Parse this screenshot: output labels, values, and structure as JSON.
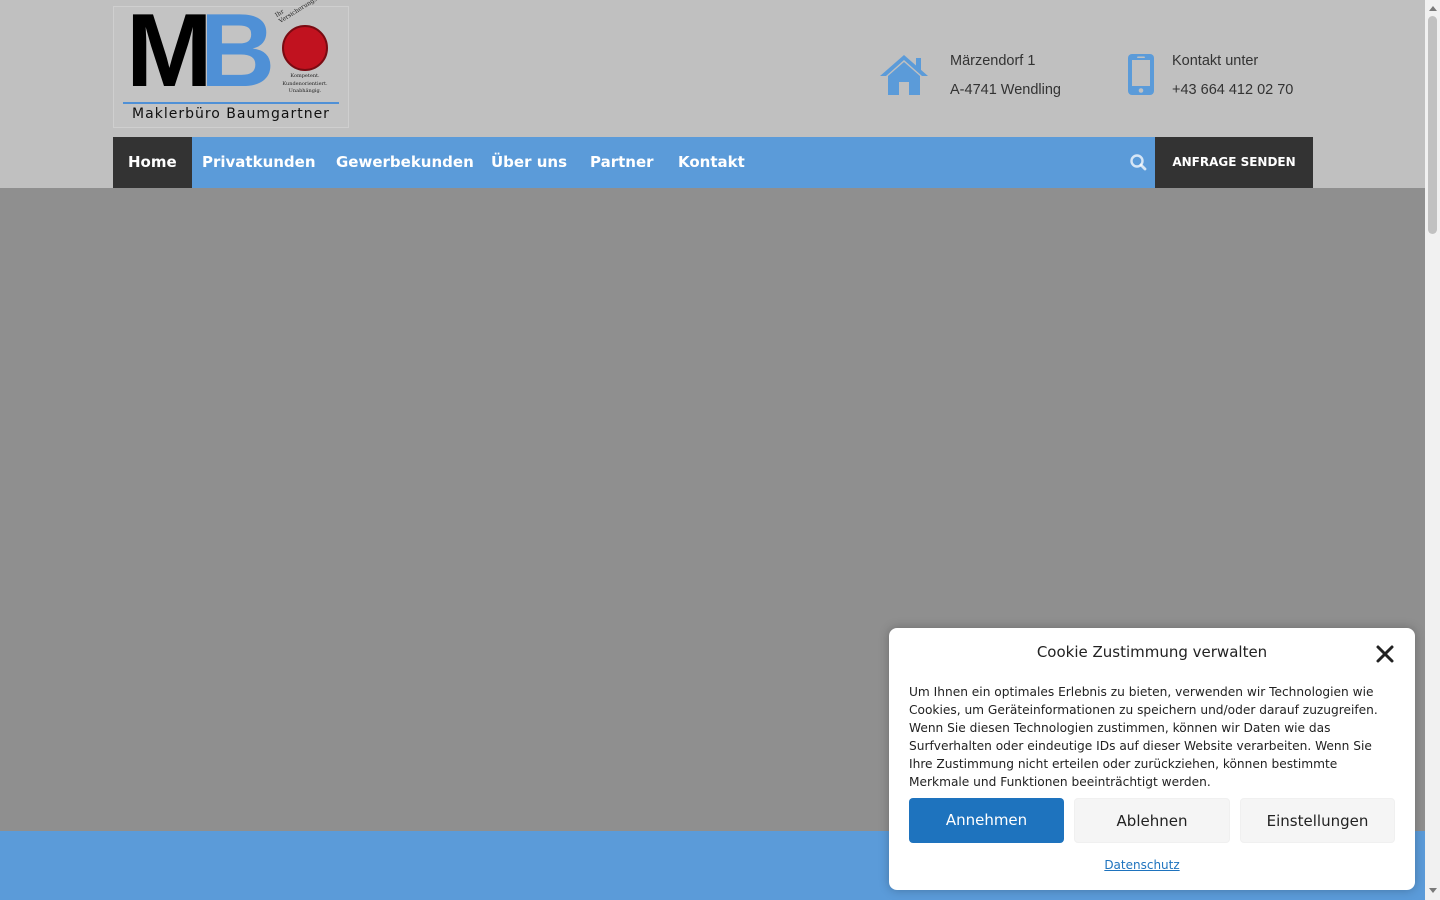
{
  "logo": {
    "letters_m": "M",
    "letters_b": "B",
    "name": "Maklerbüro Baumgartner",
    "seal_arc": "Ihr Versicherungsmakler",
    "seal_lines": "Kompetent. Kundenorientiert. Unabhängig."
  },
  "address": {
    "icon": "home-icon",
    "line1": "Märzendorf 1",
    "line2": "A-4741 Wendling"
  },
  "contact": {
    "icon": "mobile-phone-icon",
    "line1": "Kontakt unter",
    "line2": "+43 664 412 02 70"
  },
  "nav": {
    "items": [
      {
        "label": "Home",
        "active": true
      },
      {
        "label": "Privatkunden"
      },
      {
        "label": "Gewerbekunden"
      },
      {
        "label": "Über uns"
      },
      {
        "label": "Partner"
      },
      {
        "label": "Kontakt"
      }
    ],
    "search_icon": "search-icon",
    "cta_label": "ANFRAGE SENDEN"
  },
  "cookie": {
    "title": "Cookie Zustimmung verwalten",
    "body": "Um Ihnen ein optimales Erlebnis zu bieten, verwenden wir Technologien wie Cookies, um Geräteinformationen zu speichern und/oder darauf zuzugreifen. Wenn Sie diesen Technologien zustimmen, können wir Daten wie das Surfverhalten oder eindeutige IDs auf dieser Website verarbeiten. Wenn Sie Ihre Zustimmung nicht erteilen oder zurückziehen, können bestimmte Merkmale und Funktionen beeinträchtigt werden.",
    "accept_label": "Annehmen",
    "deny_label": "Ablehnen",
    "settings_label": "Einstellungen",
    "privacy_link": "Datenschutz"
  },
  "colors": {
    "brand_blue": "#5b9bd9",
    "dark": "#333333",
    "button_blue": "#1e73be"
  }
}
